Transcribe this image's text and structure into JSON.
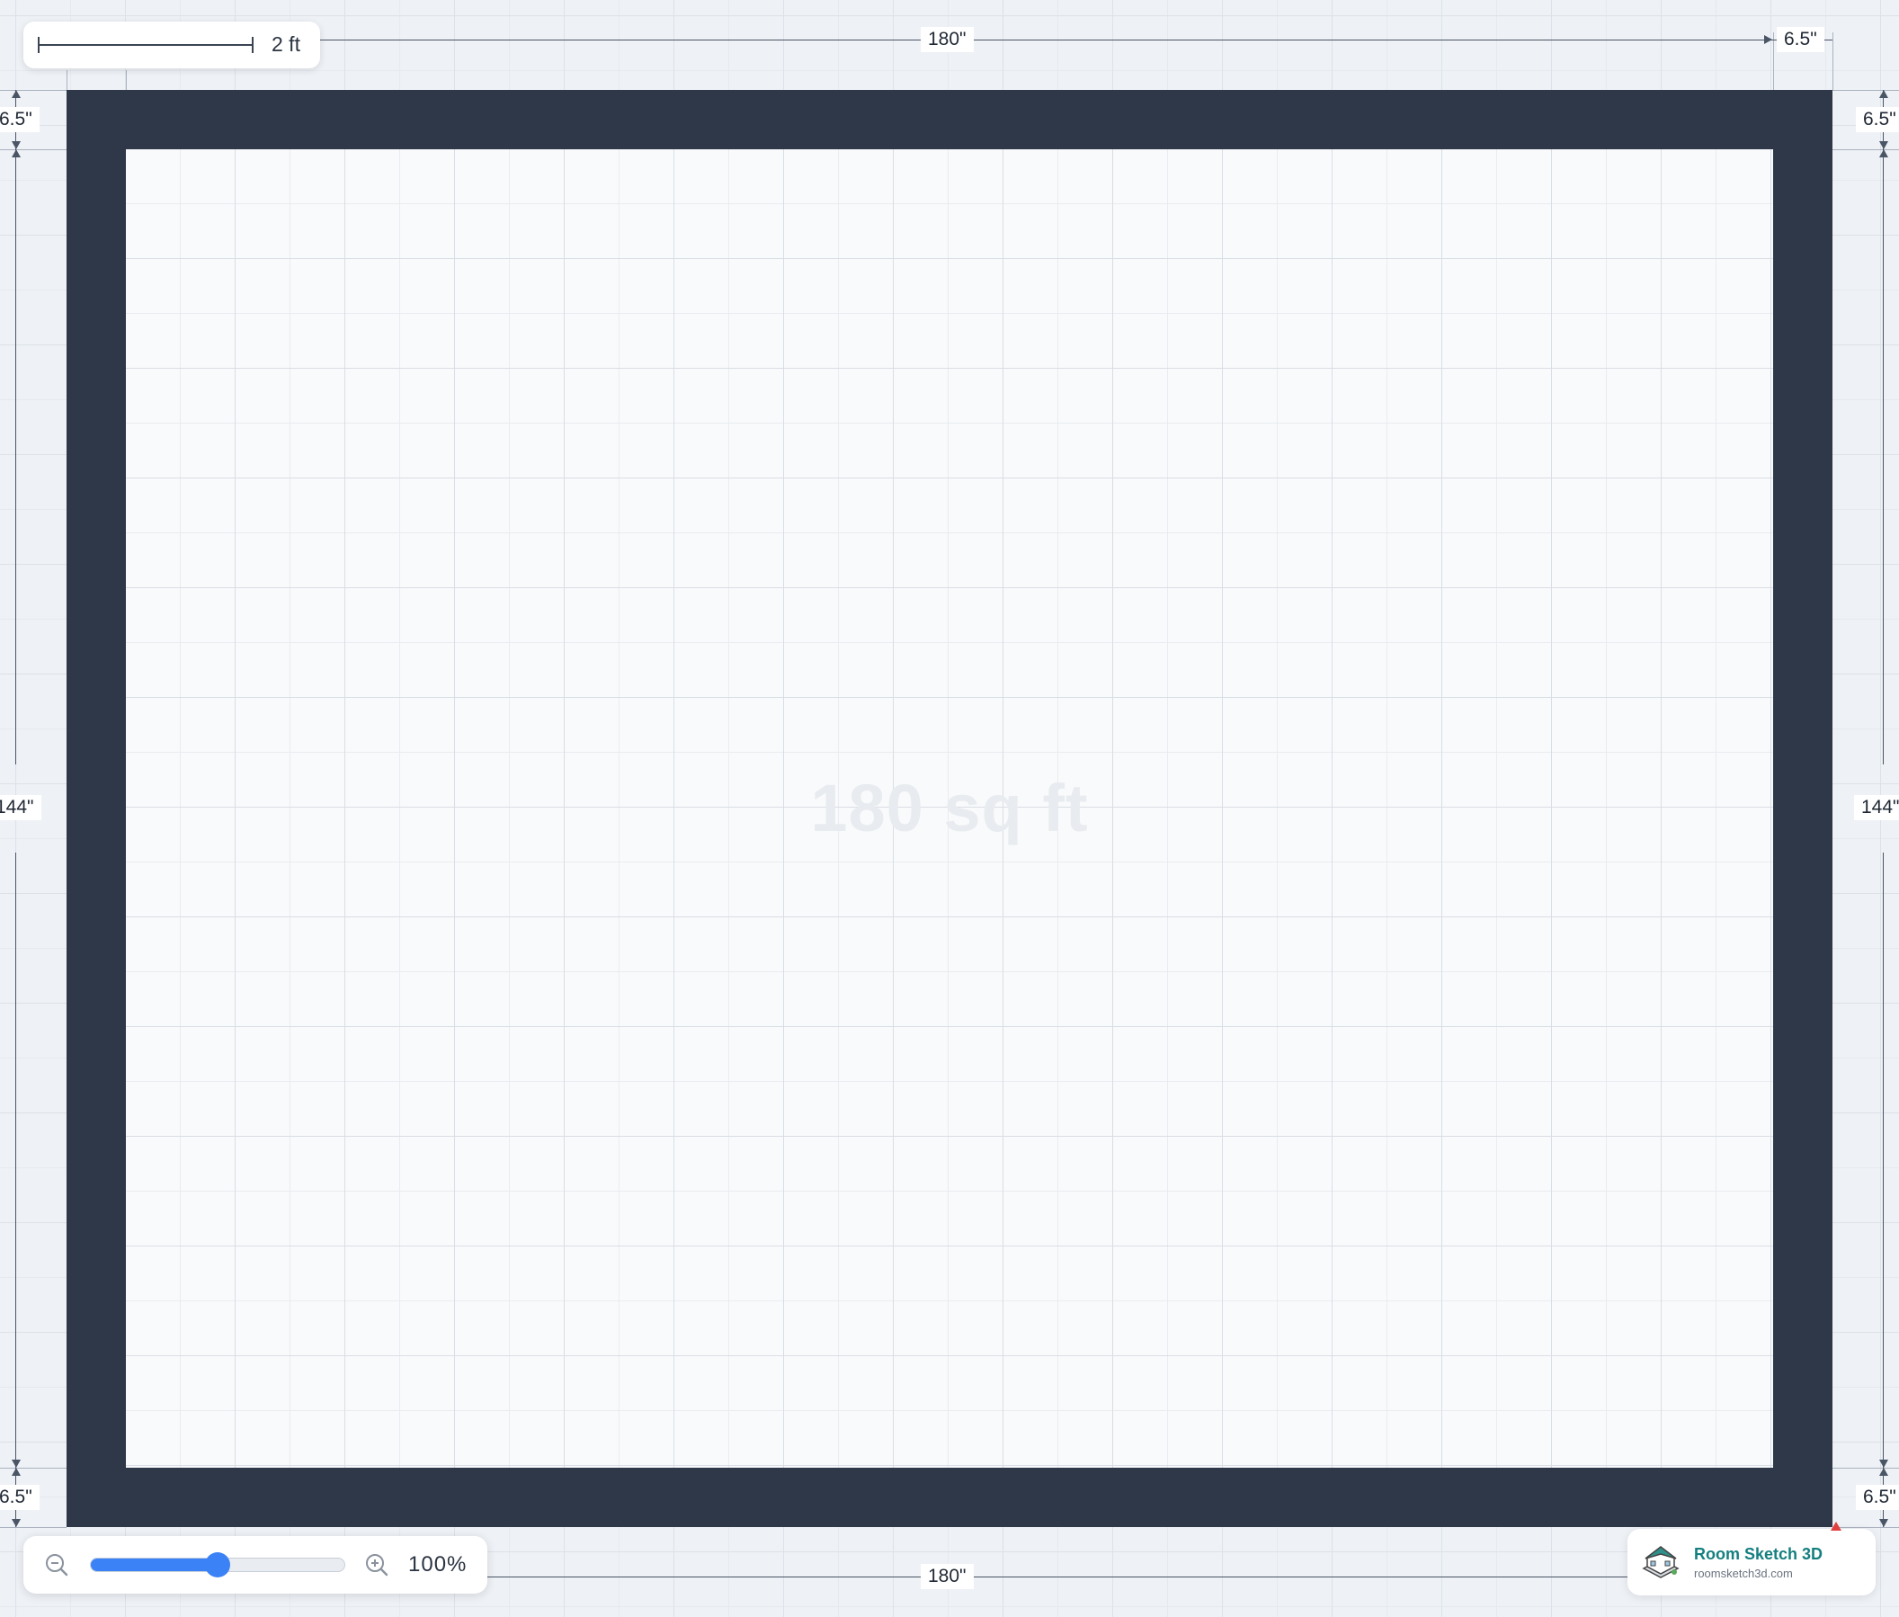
{
  "floor_plan": {
    "area_label": "180 sq ft",
    "dimensions": {
      "top_width": "180\"",
      "bottom_width": "180\"",
      "top_right_wall": "6.5\"",
      "left_height": "144\"",
      "right_height": "144\"",
      "left_top_wall": "6.5\"",
      "right_top_wall": "6.5\"",
      "left_bottom_wall": "6.5\"",
      "right_bottom_wall": "6.5\""
    },
    "colors": {
      "wall": "#2e3849",
      "floor": "#f9fafb",
      "grid_background": "#eef1f5"
    }
  },
  "scale_indicator": {
    "label": "2 ft"
  },
  "zoom_control": {
    "value_text": "100%",
    "slider_fraction": 0.5,
    "zoom_out_icon": "zoom-out-icon",
    "zoom_in_icon": "zoom-in-icon",
    "accent_color": "#3b82f6"
  },
  "branding": {
    "name": "Room Sketch 3D",
    "url": "roomsketch3d.com",
    "logo_icon": "house-logo-icon",
    "name_color": "#157f7f"
  }
}
